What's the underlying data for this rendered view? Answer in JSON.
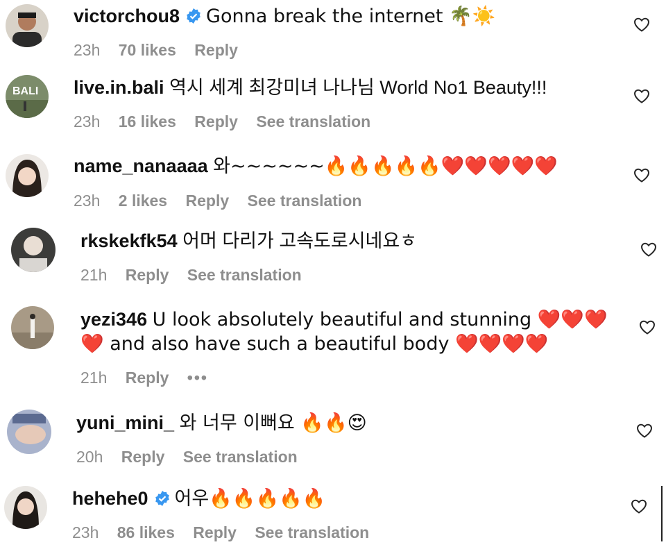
{
  "comments": [
    {
      "username": "victorchou8",
      "verified": true,
      "text": "Gonna break the internet 🌴☀️",
      "time": "23h",
      "likes": "70 likes",
      "reply": "Reply",
      "translate": ""
    },
    {
      "username": "live.in.bali",
      "verified": false,
      "text": "역시 세계 최강미녀 나나님 World No1 Beauty!!!",
      "time": "23h",
      "likes": "16 likes",
      "reply": "Reply",
      "translate": "See translation"
    },
    {
      "username": "name_nanaaaa",
      "verified": false,
      "text": "와~~~~~~🔥🔥🔥🔥🔥❤️❤️❤️❤️❤️",
      "time": "23h",
      "likes": "2 likes",
      "reply": "Reply",
      "translate": "See translation"
    },
    {
      "username": "rkskekfk54",
      "verified": false,
      "text": "어머 다리가 고속도로시네요ㅎ",
      "time": "21h",
      "likes": "",
      "reply": "Reply",
      "translate": "See translation"
    },
    {
      "username": "yezi346",
      "verified": false,
      "text": "U look absolutely beautiful and stunning ❤️❤️❤️",
      "text2": "❤️ and also have such a beautiful body ❤️❤️❤️❤️",
      "time": "21h",
      "likes": "",
      "reply": "Reply",
      "translate": "",
      "more": "•••"
    },
    {
      "username": "yuni_mini_",
      "verified": false,
      "text": "와 너무 이뻐요 🔥🔥😍",
      "time": "20h",
      "likes": "",
      "reply": "Reply",
      "translate": "See translation"
    },
    {
      "username": "hehehe0",
      "verified": true,
      "text": "어우🔥🔥🔥🔥🔥",
      "time": "23h",
      "likes": "86 likes",
      "reply": "Reply",
      "translate": "See translation"
    }
  ],
  "colors": {
    "meta": "#8e8e8e",
    "verified": "#3897f0"
  }
}
